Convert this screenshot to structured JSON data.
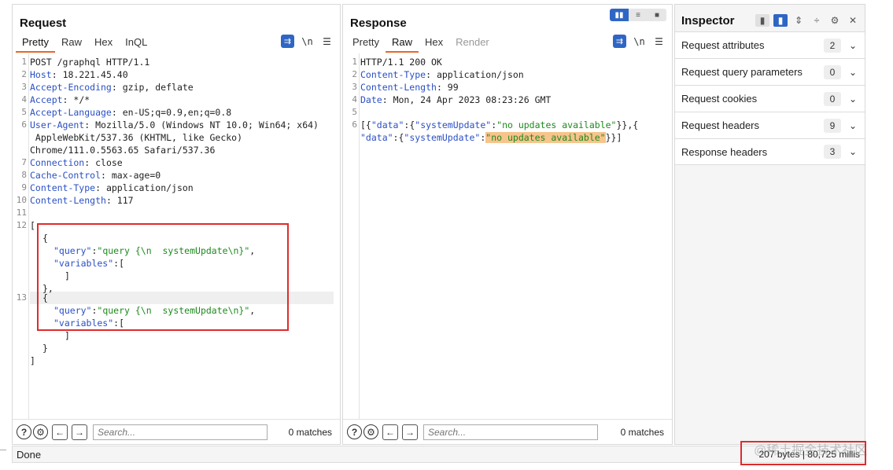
{
  "request": {
    "title": "Request",
    "tabs": [
      "Pretty",
      "Raw",
      "Hex",
      "InQL"
    ],
    "active_tab": "Pretty",
    "line_numbers": [
      "1",
      "2",
      "3",
      "4",
      "5",
      "6",
      "7",
      "8",
      "9",
      "10",
      "11",
      "12",
      "13"
    ],
    "headers": [
      {
        "key": "",
        "value": "POST /graphql HTTP/1.1"
      },
      {
        "key": "Host",
        "value": " 18.221.45.40"
      },
      {
        "key": "Accept-Encoding",
        "value": " gzip, deflate"
      },
      {
        "key": "Accept",
        "value": " */*"
      },
      {
        "key": "Accept-Language",
        "value": " en-US;q=0.9,en;q=0.8"
      },
      {
        "key": "User-Agent",
        "value": " Mozilla/5.0 (Windows NT 10.0; Win64; x64)"
      },
      {
        "key": "",
        "value": " AppleWebKit/537.36 (KHTML, like Gecko)"
      },
      {
        "key": "",
        "value": "Chrome/111.0.5563.65 Safari/537.36"
      },
      {
        "key": "Connection",
        "value": " close"
      },
      {
        "key": "Cache-Control",
        "value": " max-age=0"
      },
      {
        "key": "Content-Type",
        "value": " application/json"
      },
      {
        "key": "Content-Length",
        "value": " 117"
      }
    ],
    "body": {
      "open": "[",
      "obj_open": "{",
      "query_key": "\"query\"",
      "query_value": "\"query {\\n  systemUpdate\\n}\"",
      "variables_key": "\"variables\"",
      "arr_open": "[",
      "arr_close": "]",
      "obj_close_comma": "},",
      "obj_close": "}",
      "close": "]"
    },
    "search_placeholder": "Search...",
    "matches": "0 matches"
  },
  "response": {
    "title": "Response",
    "tabs": [
      "Pretty",
      "Raw",
      "Hex",
      "Render"
    ],
    "active_tab": "Raw",
    "line_numbers": [
      "1",
      "2",
      "3",
      "4",
      "5",
      "6"
    ],
    "status_line": "HTTP/1.1 200 OK",
    "headers": [
      {
        "key": "Content-Type",
        "value": " application/json"
      },
      {
        "key": "Content-Length",
        "value": " 99"
      },
      {
        "key": "Date",
        "value": " Mon, 24 Apr 2023 08:23:26 GMT"
      }
    ],
    "body": {
      "line1_a": "[{",
      "data_key": "\"data\"",
      "colon_brace": ":{",
      "su_key": "\"systemUpdate\"",
      "colon": ":",
      "su_value": "\"no updates available\"",
      "line1_end": "}},{",
      "line2_end": "}}]"
    },
    "search_placeholder": "Search...",
    "matches": "0 matches"
  },
  "inspector": {
    "title": "Inspector",
    "rows": [
      {
        "label": "Request attributes",
        "count": "2"
      },
      {
        "label": "Request query parameters",
        "count": "0"
      },
      {
        "label": "Request cookies",
        "count": "0"
      },
      {
        "label": "Request headers",
        "count": "9"
      },
      {
        "label": "Response headers",
        "count": "3"
      }
    ]
  },
  "status": {
    "text": "Done",
    "stats": "207 bytes | 80,725 millis"
  },
  "watermark": "@稀土掘金技术社区"
}
